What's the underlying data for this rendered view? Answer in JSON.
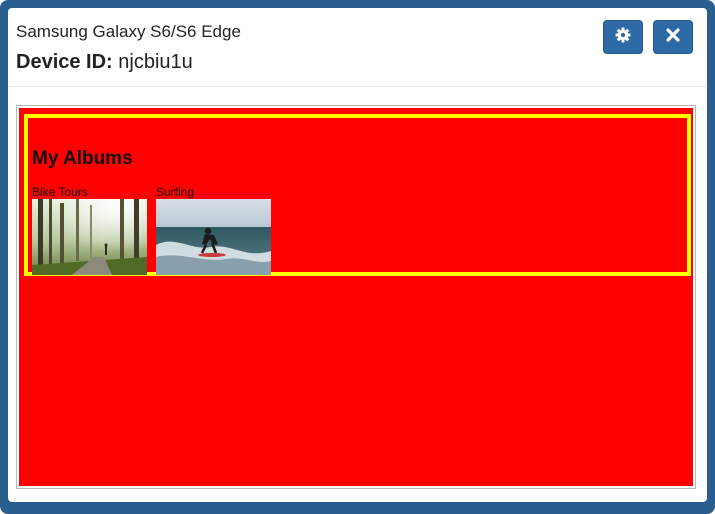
{
  "header": {
    "device_name": "Samsung Galaxy S6/S6 Edge",
    "device_id_label": "Device ID:",
    "device_id_value": "njcbiu1u",
    "settings_icon": "gear-icon",
    "close_icon": "close-icon"
  },
  "screen": {
    "background_color": "#ff0000",
    "albums_box_border_color": "#ffff00",
    "albums_title": "My Albums",
    "albums": [
      {
        "label": "Bike Tours"
      },
      {
        "label": "Surfing"
      }
    ]
  },
  "colors": {
    "frame": "#2a5e8e",
    "button": "#2d6aa6"
  }
}
